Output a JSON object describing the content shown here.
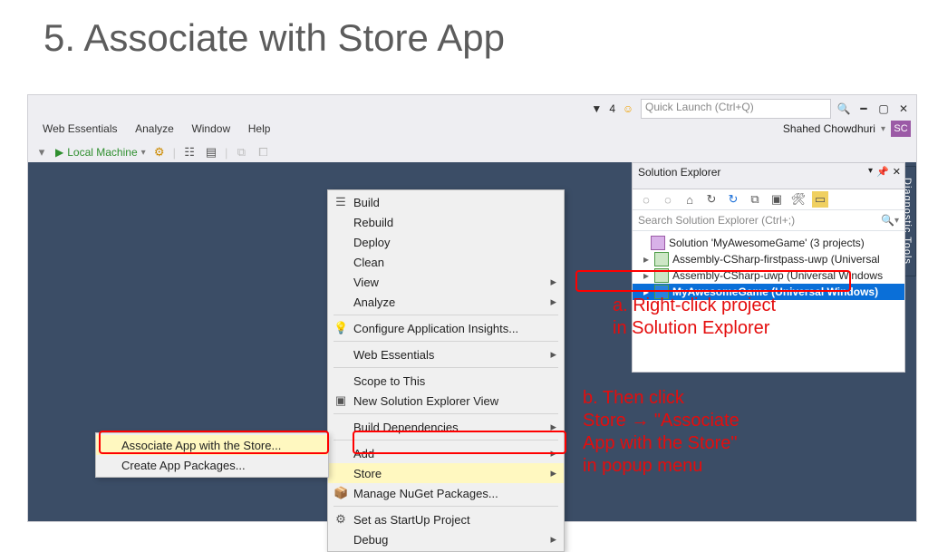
{
  "slide": {
    "title": "5. Associate with Store App"
  },
  "titlebar": {
    "filter_count": "4",
    "quicklaunch_placeholder": "Quick Launch (Ctrl+Q)"
  },
  "menus": {
    "m0": "Web Essentials",
    "m1": "Analyze",
    "m2": "Window",
    "m3": "Help"
  },
  "user": {
    "name": "Shahed Chowdhuri",
    "initials": "SC"
  },
  "toolbar": {
    "run_label": "Local Machine"
  },
  "solx": {
    "title": "Solution Explorer",
    "search_placeholder": "Search Solution Explorer (Ctrl+;)",
    "root": "Solution 'MyAwesomeGame' (3 projects)",
    "proj1": "Assembly-CSharp-firstpass-uwp (Universal",
    "proj2": "Assembly-CSharp-uwp (Universal Windows",
    "proj3": "MyAwesomeGame (Universal Windows)"
  },
  "ctx": {
    "build": "Build",
    "rebuild": "Rebuild",
    "deploy": "Deploy",
    "clean": "Clean",
    "view": "View",
    "analyze": "Analyze",
    "cai": "Configure Application Insights...",
    "we": "Web Essentials",
    "scope": "Scope to This",
    "nsev": "New Solution Explorer View",
    "bdep": "Build Dependencies",
    "add": "Add",
    "store": "Store",
    "nuget": "Manage NuGet Packages...",
    "startup": "Set as StartUp Project",
    "debug": "Debug"
  },
  "subctx": {
    "assoc": "Associate App with the Store...",
    "pkgs": "Create App Packages..."
  },
  "annot": {
    "a1": "a. Right-click project",
    "a2": "in Solution Explorer",
    "b1": "b. Then click",
    "b2": "Store → \"Associate",
    "b3": "App with the Store\"",
    "b4": "in popup menu"
  },
  "diag": "Diagnostic Tools"
}
